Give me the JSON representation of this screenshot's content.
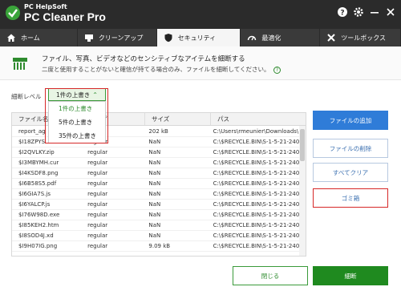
{
  "app": {
    "brand_small": "PC HelpSoft",
    "brand_big": "PC Cleaner Pro"
  },
  "titlebar_icons": [
    "help-icon",
    "gear-icon",
    "minimize-icon",
    "close-icon"
  ],
  "tabs": [
    {
      "label": "ホーム",
      "icon": "home-icon",
      "active": false
    },
    {
      "label": "クリーンアップ",
      "icon": "broom-icon",
      "active": false
    },
    {
      "label": "セキュリティ",
      "icon": "shield-icon",
      "active": true
    },
    {
      "label": "最適化",
      "icon": "speedometer-icon",
      "active": false
    },
    {
      "label": "ツールボックス",
      "icon": "tools-icon",
      "active": false
    }
  ],
  "header": {
    "title": "ファイル、写真、ビデオなどのセンシティブなアイテムを細断する",
    "subtitle": "二度と使用することがないと確信が持てる場合のみ、ファイルを細断してください。"
  },
  "level": {
    "label": "細断レベル",
    "selected": "1件の上書き",
    "options": [
      "1件の上書き",
      "5件の上書き",
      "35件の上書き"
    ]
  },
  "table": {
    "columns": [
      "ファイル名",
      "タイプ",
      "サイズ",
      "パス"
    ],
    "rows": [
      [
        "report_ag",
        "",
        "202 kB",
        "C:\\Users\\rmeunier\\Downloads\\"
      ],
      [
        "$I18ZPYS",
        "regular",
        "NaN",
        "C:\\$RECYCLE.BIN\\S-1-5-21-240"
      ],
      [
        "$I2QVLKY.zip",
        "regular",
        "NaN",
        "C:\\$RECYCLE.BIN\\S-1-5-21-240"
      ],
      [
        "$I3MBYMH.cur",
        "regular",
        "NaN",
        "C:\\$RECYCLE.BIN\\S-1-5-21-240"
      ],
      [
        "$I4KSDF8.png",
        "regular",
        "NaN",
        "C:\\$RECYCLE.BIN\\S-1-5-21-240"
      ],
      [
        "$I6B58S5.pdf",
        "regular",
        "NaN",
        "C:\\$RECYCLE.BIN\\S-1-5-21-240"
      ],
      [
        "$I6GIA7S.js",
        "regular",
        "NaN",
        "C:\\$RECYCLE.BIN\\S-1-5-21-240"
      ],
      [
        "$I6YALCP.js",
        "regular",
        "NaN",
        "C:\\$RECYCLE.BIN\\S-1-5-21-240"
      ],
      [
        "$I76W98D.exe",
        "regular",
        "NaN",
        "C:\\$RECYCLE.BIN\\S-1-5-21-240"
      ],
      [
        "$I85KEH2.htm",
        "regular",
        "NaN",
        "C:\\$RECYCLE.BIN\\S-1-5-21-240"
      ],
      [
        "$I8SOD4J.xd",
        "regular",
        "NaN",
        "C:\\$RECYCLE.BIN\\S-1-5-21-240"
      ],
      [
        "$I9H07IG.png",
        "regular",
        "9.09 kB",
        "C:\\$RECYCLE.BIN\\S-1-5-21-240"
      ]
    ]
  },
  "buttons": {
    "add": "ファイルの追加",
    "delete": "ファイルの削除",
    "clear_all": "すべてクリア",
    "trash": "ゴミ箱",
    "close": "閉じる",
    "shred": "細断"
  },
  "colors": {
    "accent_green": "#1f8a1f",
    "accent_blue": "#2f7cd8",
    "highlight_red": "#d62828",
    "titlebar": "#2b2b2b"
  }
}
